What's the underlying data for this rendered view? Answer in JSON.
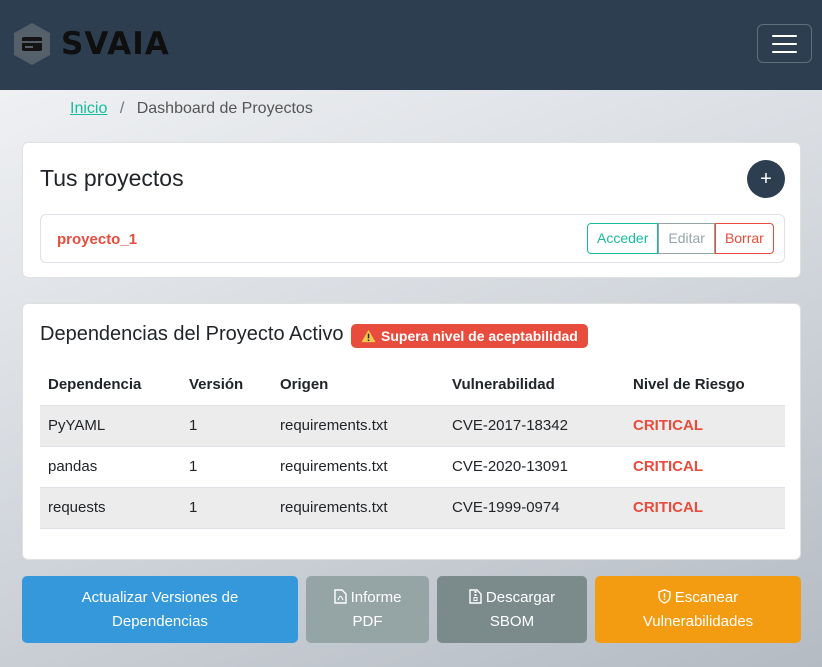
{
  "header": {
    "logo_text": "SVAIA",
    "colors": {
      "navbar": "#2c3e50"
    }
  },
  "breadcrumb": {
    "home": "Inicio",
    "separator": "/",
    "current": "Dashboard de Proyectos"
  },
  "projects": {
    "title": "Tus proyectos",
    "add_label": "+",
    "items": [
      {
        "name": "proyecto_1",
        "access": "Acceder",
        "edit": "Editar",
        "delete": "Borrar"
      }
    ]
  },
  "dependencies": {
    "title": "Dependencias del Proyecto Activo",
    "alert": "Supera nivel de aceptabilidad",
    "columns": [
      "Dependencia",
      "Versión",
      "Origen",
      "Vulnerabilidad",
      "Nivel de Riesgo"
    ],
    "rows": [
      [
        "PyYAML",
        "1",
        "requirements.txt",
        "CVE-2017-18342",
        "CRITICAL"
      ],
      [
        "pandas",
        "1",
        "requirements.txt",
        "CVE-2020-13091",
        "CRITICAL"
      ],
      [
        "requests",
        "1",
        "requirements.txt",
        "CVE-1999-0974",
        "CRITICAL"
      ]
    ]
  },
  "actions": {
    "update_line1": "Actualizar Versiones de",
    "update_line2": "Dependencias",
    "pdf_line1": "Informe",
    "pdf_line2": "PDF",
    "sbom_line1": "Descargar",
    "sbom_line2": "SBOM",
    "scan_line1": "Escanear",
    "scan_line2": "Vulnerabilidades"
  },
  "icons": [
    "logo-mark-icon",
    "hamburger-icon",
    "warning-triangle-icon",
    "pdf-file-icon",
    "zip-file-icon",
    "shield-icon"
  ]
}
